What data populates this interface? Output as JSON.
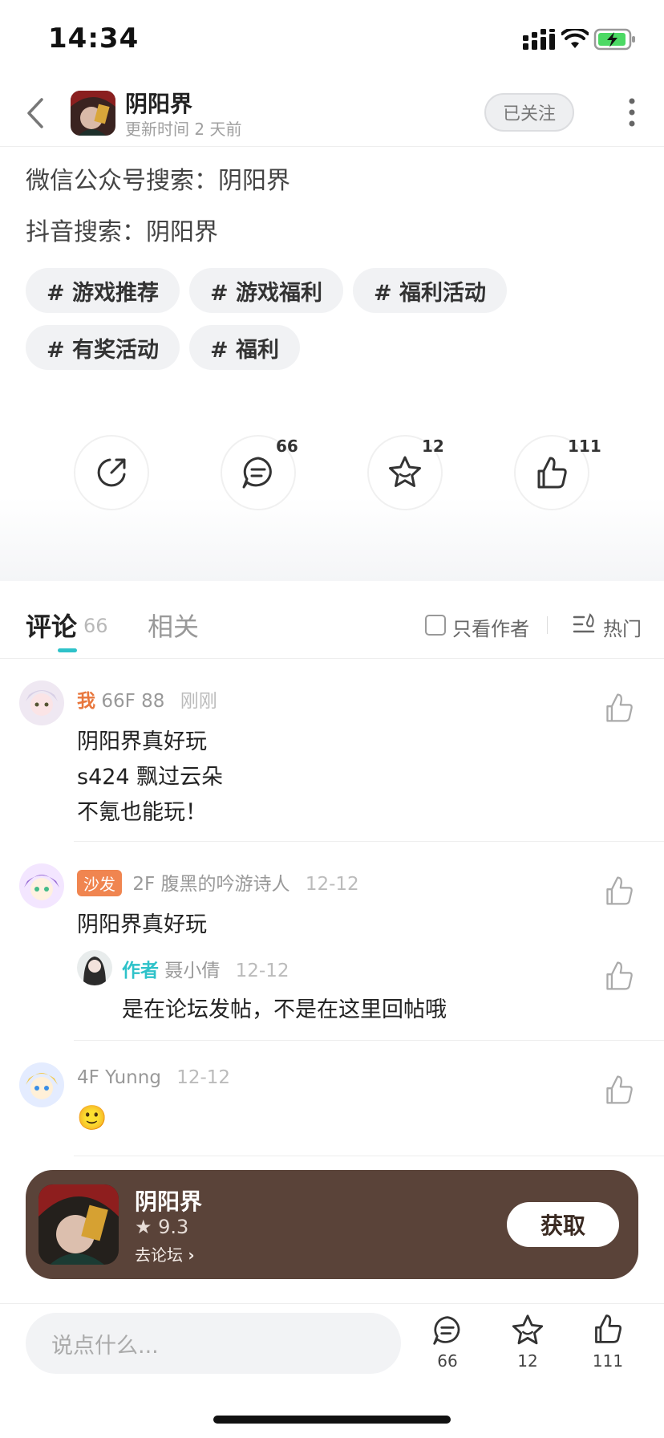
{
  "status_bar": {
    "time": "14:34"
  },
  "header": {
    "title": "阴阳界",
    "subtitle": "更新时间 2 天前",
    "follow_label": "已关注"
  },
  "post": {
    "lines": [
      "微信公众号搜索：阴阳界",
      "抖音搜索：阴阳界"
    ],
    "tags": [
      "# 游戏推荐",
      "# 游戏福利",
      "# 福利活动",
      "# 有奖活动",
      "# 福利"
    ]
  },
  "actions": {
    "comment_count": "66",
    "favorite_count": "12",
    "like_count": "111"
  },
  "tabs": {
    "comments_label": "评论",
    "comments_count": "66",
    "related_label": "相关",
    "author_only_label": "只看作者",
    "hot_label": "热门"
  },
  "comments": [
    {
      "badge": "我",
      "floor_user": "66F 88",
      "time": "刚刚",
      "lines": [
        "阴阳界真好玩",
        "s424 飘过云朵",
        "不氪也能玩！"
      ]
    },
    {
      "badge": "沙发",
      "floor_user": "2F 腹黑的吟游诗人",
      "time": "12-12",
      "lines": [
        "阴阳界真好玩"
      ],
      "reply": {
        "badge": "作者",
        "user": "聂小倩",
        "time": "12-12",
        "text": "是在论坛发帖，不是在这里回帖哦"
      }
    },
    {
      "floor_user": "4F Yunng",
      "time": "12-12",
      "emoji": "🙂"
    }
  ],
  "app_card": {
    "name": "阴阳界",
    "rating": "9.3",
    "forum_link": "去论坛",
    "get_label": "获取"
  },
  "bottom_bar": {
    "placeholder": "说点什么...",
    "comment_count": "66",
    "favorite_count": "12",
    "like_count": "111"
  }
}
